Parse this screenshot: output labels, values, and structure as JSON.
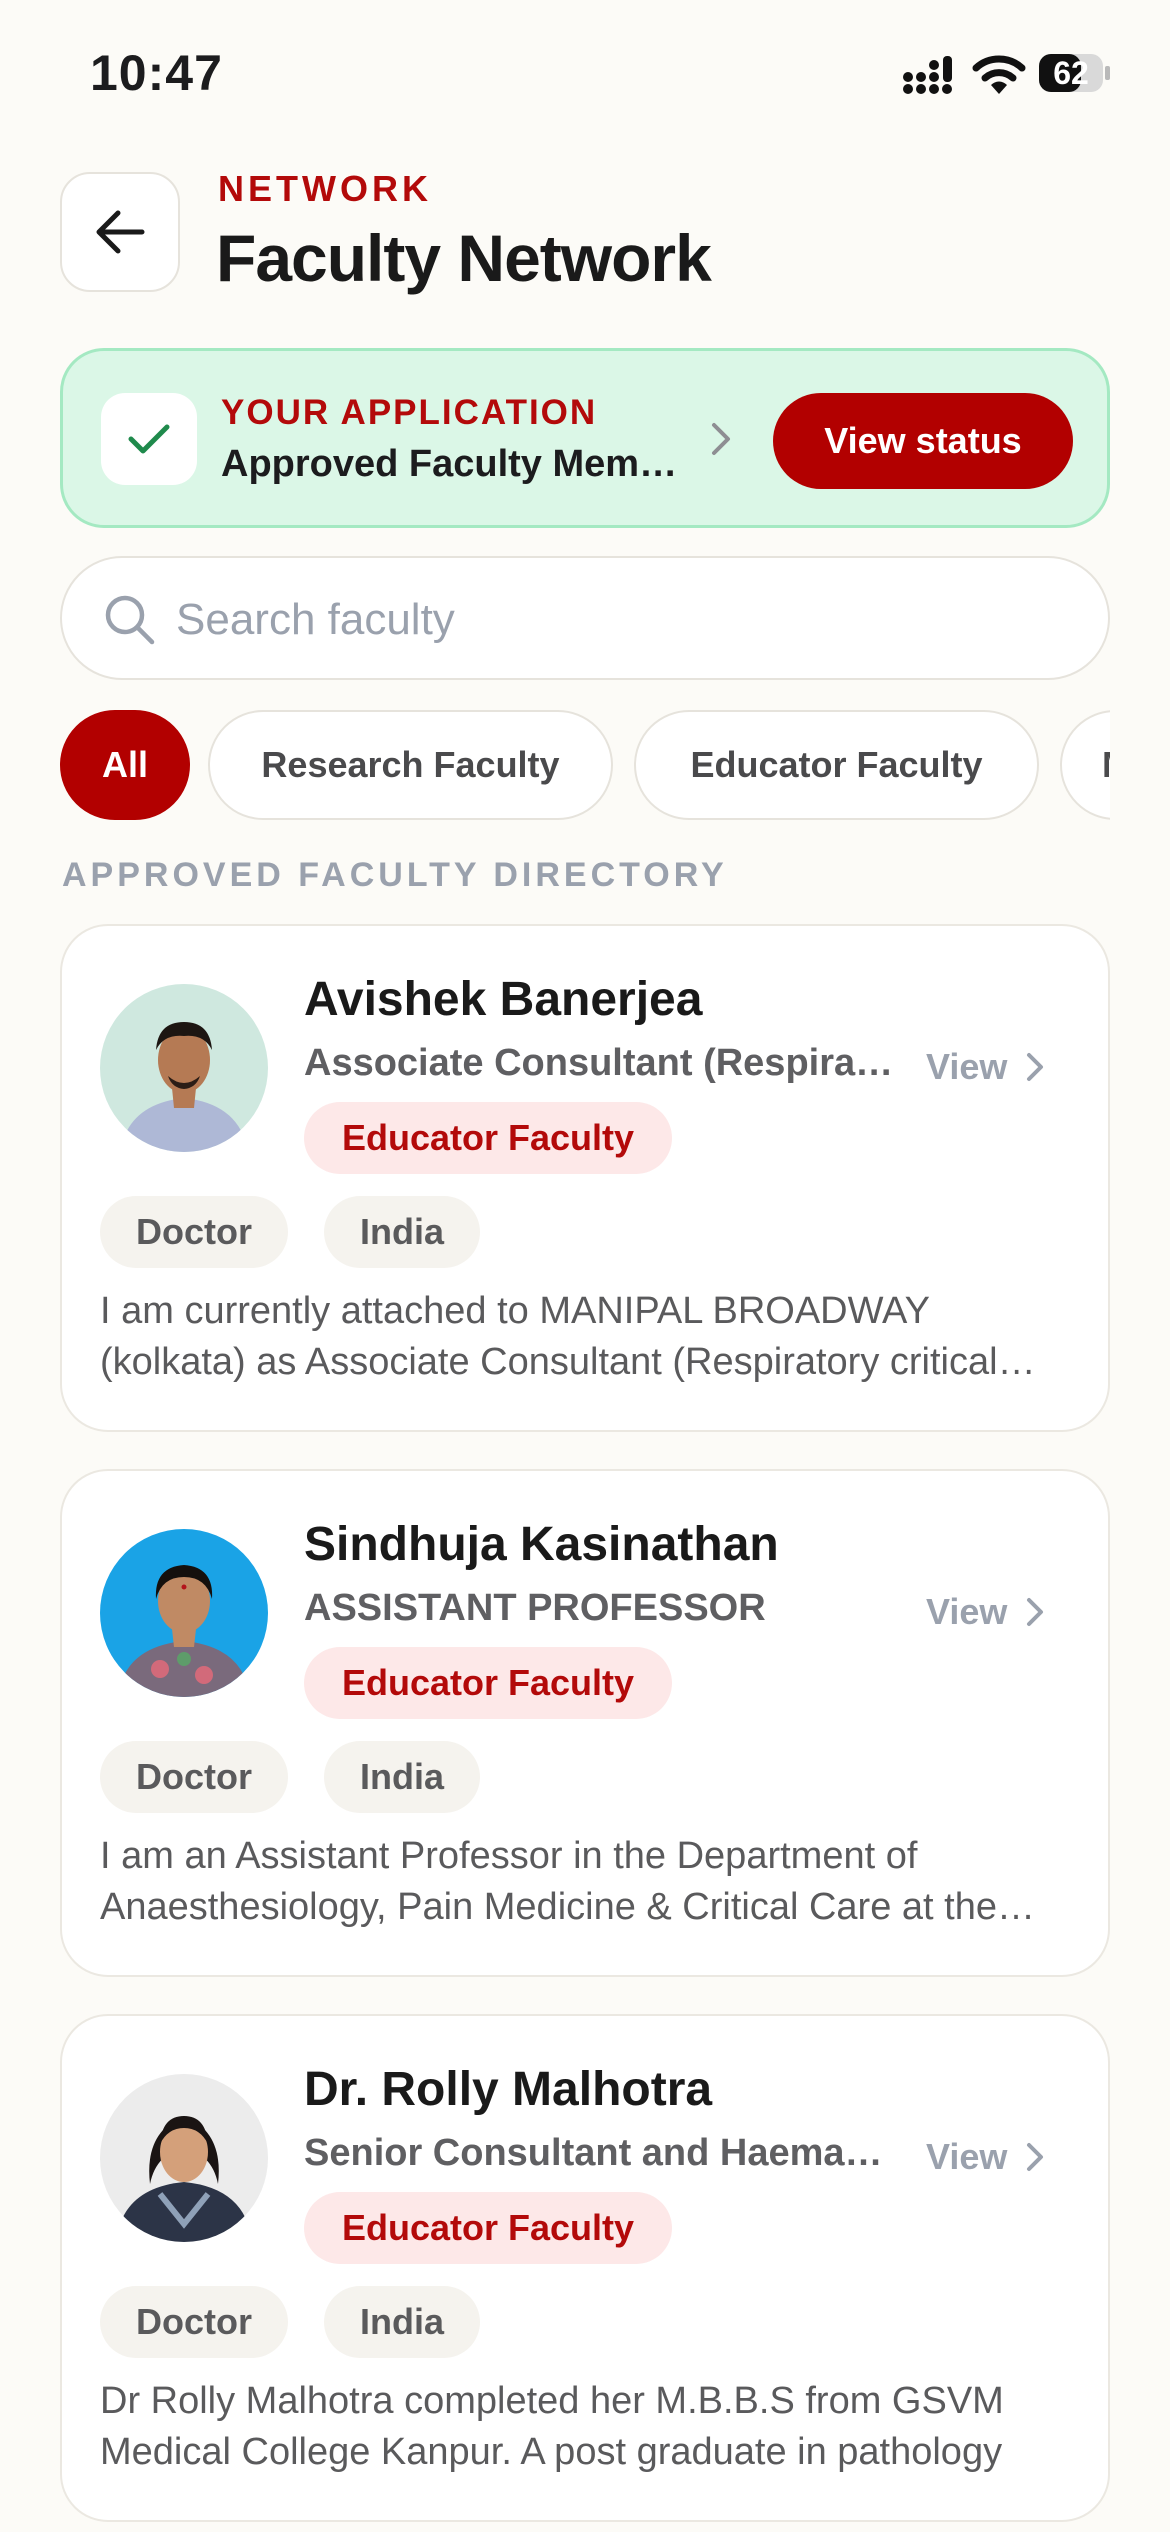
{
  "status_bar": {
    "time": "10:47",
    "battery": "62"
  },
  "header": {
    "eyebrow": "NETWORK",
    "title": "Faculty Network"
  },
  "application": {
    "label": "YOUR APPLICATION",
    "value": "Approved Faculty Member",
    "button": "View status"
  },
  "search": {
    "placeholder": "Search faculty",
    "value": ""
  },
  "filters": [
    {
      "label": "All",
      "active": true
    },
    {
      "label": "Research Faculty",
      "active": false
    },
    {
      "label": "Educator Faculty",
      "active": false
    },
    {
      "label": "M",
      "active": false
    }
  ],
  "section_label": "APPROVED FACULTY DIRECTORY",
  "view_label": "View",
  "faculty": [
    {
      "name": "Avishek Banerjea",
      "role": "Associate Consultant (Respiratory Critical Care)",
      "type": "Educator Faculty",
      "tags": [
        "Doctor",
        "India"
      ],
      "bio": "I am currently attached to MANIPAL BROADWAY (kolkata) as Associate Consultant (Respiratory critical care)"
    },
    {
      "name": "Sindhuja Kasinathan",
      "role": "ASSISTANT PROFESSOR",
      "type": "Educator Faculty",
      "tags": [
        "Doctor",
        "India"
      ],
      "bio": "I am an Assistant Professor in the Department of Anaesthesiology, Pain Medicine & Critical Care at the institute"
    },
    {
      "name": "Dr. Rolly Malhotra",
      "role": "Senior Consultant and Haematologist",
      "type": "Educator Faculty",
      "tags": [
        "Doctor",
        "India"
      ],
      "bio": "Dr Rolly Malhotra completed her M.B.B.S from GSVM Medical College Kanpur. A post graduate in pathology"
    }
  ],
  "colors": {
    "brand": "#b20000",
    "banner_bg": "#dbf7e7",
    "banner_border": "#a4e9c2",
    "badge_bg": "#fde8e8",
    "check": "#1f8a4c"
  }
}
